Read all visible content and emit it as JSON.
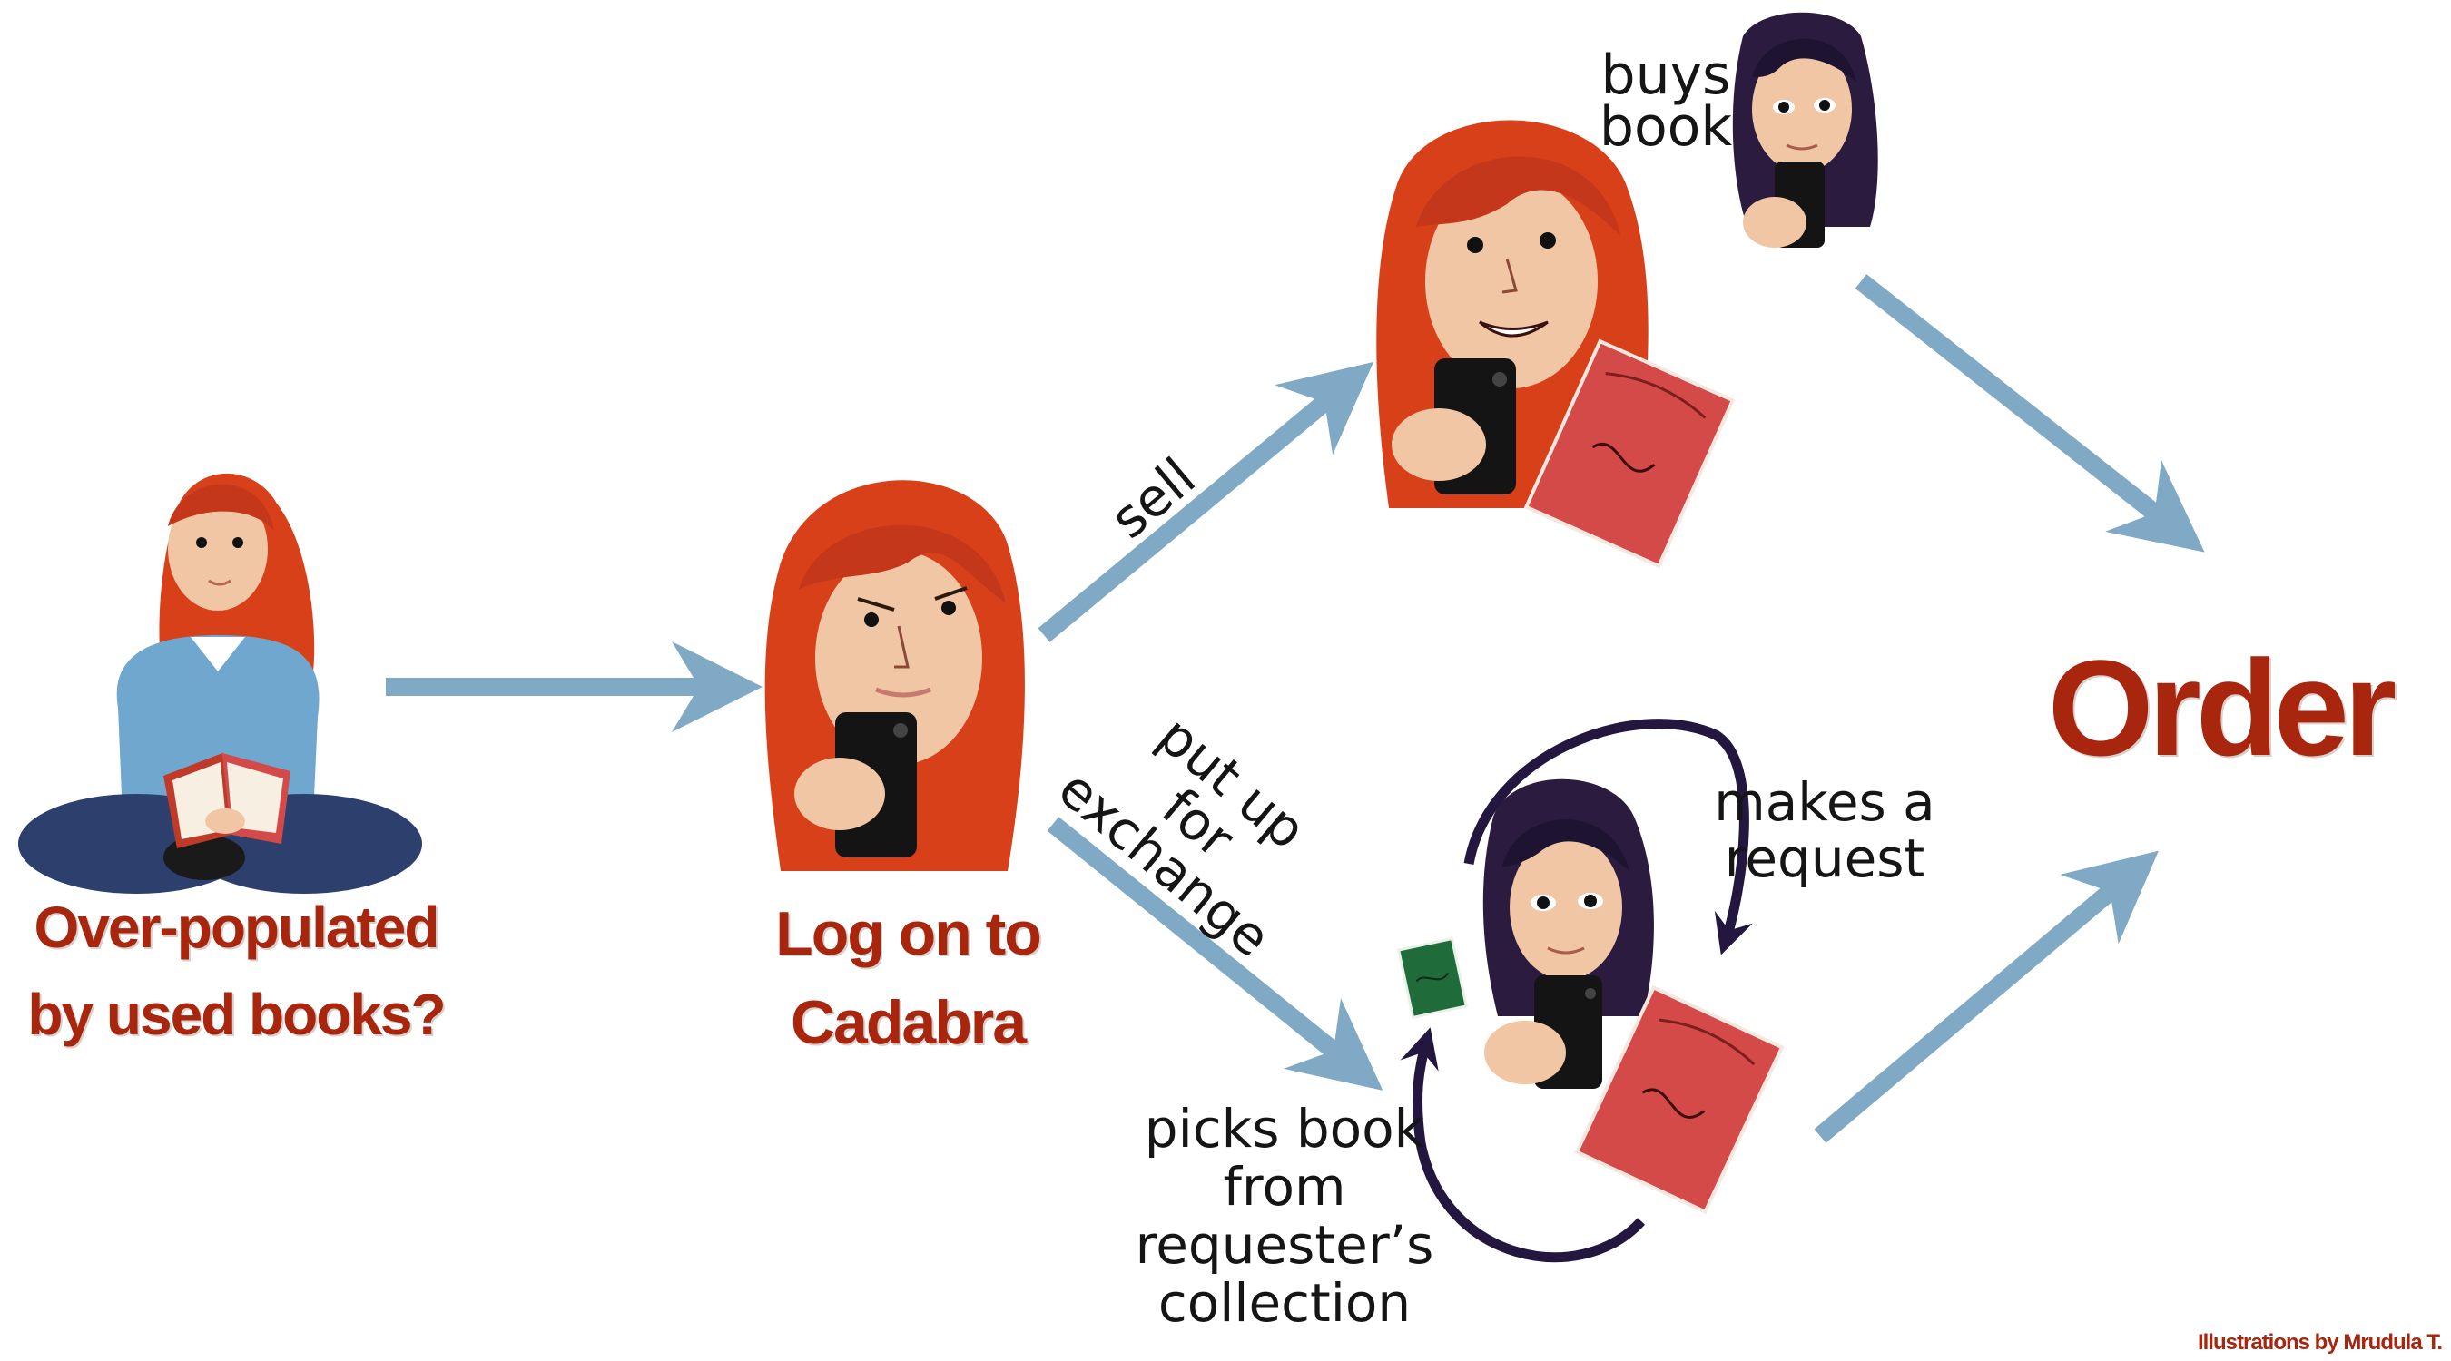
{
  "labels": {
    "start": [
      "Over-populated",
      "by used books?"
    ],
    "login": [
      "Log on to",
      "Cadabra"
    ],
    "order": "Order",
    "credit": "Illustrations by Mrudula T."
  },
  "edges": {
    "sell": "sell",
    "exchange": [
      "put up",
      "for",
      "exchange"
    ],
    "buys": [
      "buys",
      "book"
    ],
    "request": [
      "makes a",
      "request"
    ],
    "picks": [
      "picks book",
      "from",
      "requester’s",
      "collection"
    ]
  },
  "colors": {
    "arrow": "#7fa9c4",
    "cycle": "#23163f",
    "title": "#a8260d",
    "hair": "#d8401a",
    "hair_dark": "#2b1b3f",
    "skin": "#f1c6a4",
    "phone": "#141414",
    "book_red": "#d44a49",
    "book_green": "#1f6b3a",
    "sweater": "#6fa7cf",
    "jeans": "#2c3f6d"
  },
  "icons": [
    "reader-illustration",
    "user-with-phone-illustration",
    "seller-happy-illustration",
    "buyer-illustration",
    "requester-illustration",
    "red-book-icon",
    "green-book-icon"
  ]
}
